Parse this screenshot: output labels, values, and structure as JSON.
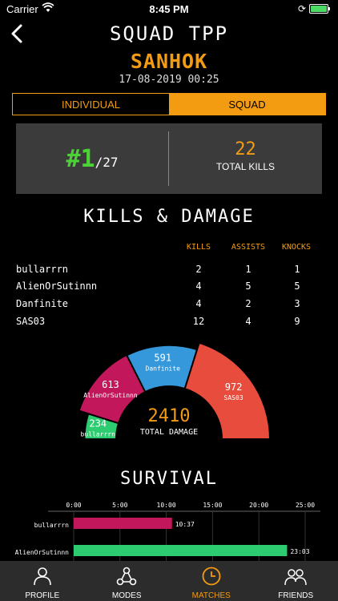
{
  "status": {
    "carrier": "Carrier",
    "time": "8:45 PM"
  },
  "header": {
    "title": "SQUAD TPP",
    "map": "SANHOK",
    "date": "17-08-2019 00:25"
  },
  "segment": {
    "individual": "INDIVIDUAL",
    "squad": "SQUAD",
    "selected": "SQUAD"
  },
  "summary": {
    "rank": "#1",
    "rank_total": "/27",
    "kills": "22",
    "kills_label": "TOTAL KILLS"
  },
  "kd": {
    "title": "KILLS & DAMAGE",
    "headers": [
      "KILLS",
      "ASSISTS",
      "KNOCKS"
    ],
    "rows": [
      {
        "name": "bullarrrn",
        "kills": "2",
        "assists": "1",
        "knocks": "1"
      },
      {
        "name": "AlienOrSutinnn",
        "kills": "4",
        "assists": "5",
        "knocks": "5"
      },
      {
        "name": "Danfinite",
        "kills": "4",
        "assists": "2",
        "knocks": "3"
      },
      {
        "name": "SAS03",
        "kills": "12",
        "assists": "4",
        "knocks": "9"
      }
    ]
  },
  "chart_data": [
    {
      "type": "pie",
      "title": "",
      "center_value": "2410",
      "center_label": "TOTAL DAMAGE",
      "slices": [
        {
          "name": "bullarrrn",
          "value": 234,
          "color": "#2ecc71"
        },
        {
          "name": "AlienOrSutinnn",
          "value": 613,
          "color": "#c2185b"
        },
        {
          "name": "Danfinite",
          "value": 591,
          "color": "#3498db"
        },
        {
          "name": "SAS03",
          "value": 972,
          "color": "#e74c3c"
        }
      ]
    },
    {
      "type": "bar",
      "title": "SURVIVAL",
      "x_ticks": [
        "0:00",
        "5:00",
        "10:00",
        "15:00",
        "20:00",
        "25:00"
      ],
      "xlim": [
        0,
        25
      ],
      "categories": [
        "bullarrrn",
        "AlienOrSutinnn"
      ],
      "values_minutes": [
        10.617,
        23.05
      ],
      "value_labels": [
        "10:37",
        "23:03"
      ],
      "colors": [
        "#c2185b",
        "#2ecc71"
      ]
    }
  ],
  "tabs": [
    {
      "label": "PROFILE",
      "icon": "person-icon"
    },
    {
      "label": "MODES",
      "icon": "network-icon"
    },
    {
      "label": "MATCHES",
      "icon": "clock-icon"
    },
    {
      "label": "FRIENDS",
      "icon": "group-icon"
    }
  ],
  "colors": {
    "accent": "#f39c12",
    "rank": "#4cd137",
    "tabbar": "#2c2c2c"
  }
}
